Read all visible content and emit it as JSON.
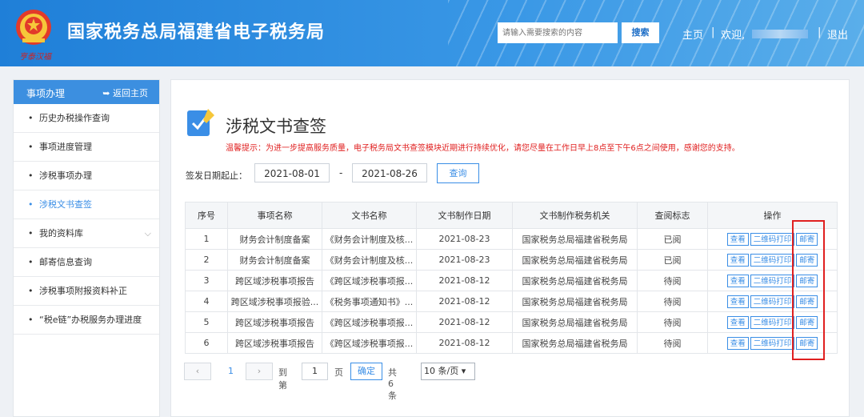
{
  "header": {
    "site_title": "国家税务总局福建省电子税务局",
    "emblem_text": "亨泰汉福",
    "search_placeholder": "请输入需要搜索的内容",
    "search_button": "搜索",
    "nav_home": "主页",
    "nav_welcome": "欢迎,",
    "nav_logout": "退出",
    "separator": "|"
  },
  "sidebar": {
    "title": "事项办理",
    "back_label": "返回主页",
    "items": [
      {
        "label": "历史办税操作查询"
      },
      {
        "label": "事项进度管理"
      },
      {
        "label": "涉税事项办理"
      },
      {
        "label": "涉税文书查签"
      },
      {
        "label": "我的资料库"
      },
      {
        "label": "邮寄信息查询"
      },
      {
        "label": "涉税事项附报资料补正"
      },
      {
        "label": "“税e链”办税服务办理进度"
      }
    ]
  },
  "main": {
    "title": "涉税文书查签",
    "notice": "温馨提示：为进一步提高服务质量，电子税务局文书查签模块近期进行持续优化，请您尽量在工作日早上8点至下午6点之间使用，感谢您的支持。",
    "date_label": "签发日期起止：",
    "date_from": "2021-08-01",
    "date_sep": "-",
    "date_to": "2021-08-26",
    "query_button": "查询"
  },
  "table": {
    "headers": [
      "序号",
      "事项名称",
      "文书名称",
      "文书制作日期",
      "文书制作税务机关",
      "查阅标志",
      "操作"
    ],
    "actions": [
      "查看",
      "二维码打印",
      "邮寄"
    ],
    "rows": [
      {
        "no": "1",
        "item": "财务会计制度备案",
        "doc": "《财务会计制度及核...",
        "date": "2021-08-23",
        "org": "国家税务总局福建省税务局",
        "flag": "已阅"
      },
      {
        "no": "2",
        "item": "财务会计制度备案",
        "doc": "《财务会计制度及核...",
        "date": "2021-08-23",
        "org": "国家税务总局福建省税务局",
        "flag": "已阅"
      },
      {
        "no": "3",
        "item": "跨区域涉税事项报告",
        "doc": "《跨区域涉税事项报...",
        "date": "2021-08-12",
        "org": "国家税务总局福建省税务局",
        "flag": "待阅"
      },
      {
        "no": "4",
        "item": "跨区域涉税事项报验...",
        "doc": "《税务事项通知书》...",
        "date": "2021-08-12",
        "org": "国家税务总局福建省税务局",
        "flag": "待阅"
      },
      {
        "no": "5",
        "item": "跨区域涉税事项报告",
        "doc": "《跨区域涉税事项报...",
        "date": "2021-08-12",
        "org": "国家税务总局福建省税务局",
        "flag": "待阅"
      },
      {
        "no": "6",
        "item": "跨区域涉税事项报告",
        "doc": "《跨区域涉税事项报...",
        "date": "2021-08-12",
        "org": "国家税务总局福建省税务局",
        "flag": "待阅"
      }
    ]
  },
  "pager": {
    "prev": "‹",
    "current": "1",
    "next": "›",
    "goto_label": "到第",
    "goto_value": "1",
    "page_unit": "页",
    "confirm": "确定",
    "total": "共 6 条",
    "page_size": "10 条/页"
  },
  "colors": {
    "accent": "#3a8ee6",
    "header": "#1f7fd8",
    "warning": "#e02020"
  }
}
